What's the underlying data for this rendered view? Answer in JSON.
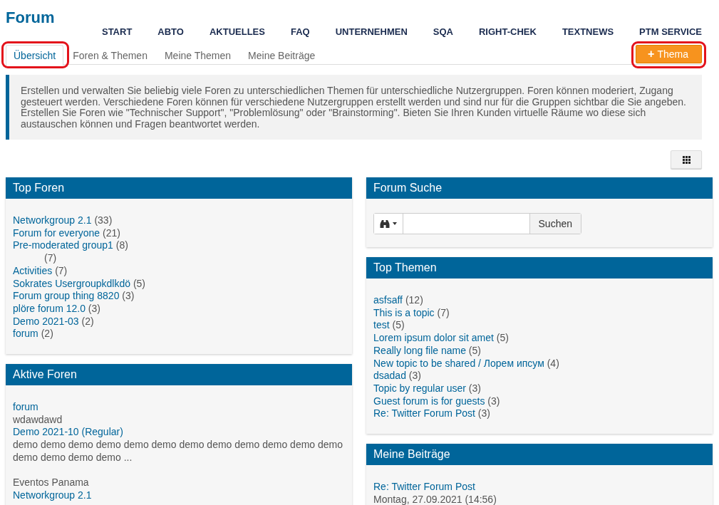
{
  "page_title": "Forum",
  "nav": [
    "START",
    "ABTO",
    "AKTUELLES",
    "FAQ",
    "UNTERNEHMEN",
    "SQA",
    "RIGHT-CHEK",
    "TEXTNEWS",
    "PTM SERVICE"
  ],
  "tabs": [
    {
      "label": "Übersicht",
      "selected": true,
      "highlighted": true
    },
    {
      "label": "Foren & Themen",
      "selected": false,
      "highlighted": false
    },
    {
      "label": "Meine Themen",
      "selected": false,
      "highlighted": false
    },
    {
      "label": "Meine Beiträge",
      "selected": false,
      "highlighted": false
    }
  ],
  "new_topic_button": {
    "icon": "+",
    "label": "Thema",
    "highlighted": true
  },
  "info_text": "Erstellen und verwalten Sie beliebig viele Foren zu unterschiedlichen Themen für unterschiedliche Nutzergruppen. Foren können moderiert, Zugang gesteuert werden. Verschiedene Foren können für verschiedene Nutzergruppen erstellt werden und sind nur für die Gruppen sichtbar die Sie angeben. Erstellen Sie Foren wie \"Technischer Support\", \"Problemlösung\" oder \"Brainstorming\". Bieten Sie Ihren Kunden virtuelle Räume wo diese sich austauschen können und Fragen beantwortet werden.",
  "top_foren": {
    "title": "Top Foren",
    "items": [
      {
        "name": "Networkgroup 2.1",
        "count": "(33)"
      },
      {
        "name": "Forum for everyone",
        "count": "(21)"
      },
      {
        "name": "Pre-moderated group1",
        "count": "(8)"
      },
      {
        "count": "(7)"
      },
      {
        "name": "Activities",
        "count": "(7)"
      },
      {
        "name": "Sokrates Usergroupkdlkdö",
        "count": "(5)"
      },
      {
        "name": "Forum group thing 8820",
        "count": "(3)"
      },
      {
        "name": "plöre forum 12.0",
        "count": "(3)"
      },
      {
        "name": "Demo 2021-03",
        "count": "(2)"
      },
      {
        "name": "forum",
        "count": "(2)"
      }
    ]
  },
  "aktive_foren": {
    "title": "Aktive Foren",
    "items": [
      {
        "kind": "link",
        "text": "forum",
        "gap_before": false
      },
      {
        "kind": "text",
        "text": "wdawdawd",
        "gap_before": false
      },
      {
        "kind": "link",
        "text": "Demo 2021-10 (Regular)",
        "gap_before": false
      },
      {
        "kind": "text",
        "text": "demo demo demo demo demo demo demo demo demo demo demo demo demo demo demo demo ...",
        "gap_before": false
      },
      {
        "kind": "text",
        "text": "Eventos Panama",
        "gap_before": true
      },
      {
        "kind": "link",
        "text": "Networkgroup 2.1",
        "gap_before": false
      }
    ]
  },
  "forum_suche": {
    "title": "Forum Suche",
    "button": "Suchen"
  },
  "top_themen": {
    "title": "Top Themen",
    "items": [
      {
        "name": "asfsaff",
        "count": "(12)"
      },
      {
        "name": "This is a topic",
        "count": "(7)"
      },
      {
        "name": "test",
        "count": "(5)"
      },
      {
        "name": "Lorem ipsum dolor sit amet",
        "count": "(5)"
      },
      {
        "name": "Really long file name",
        "count": "(5)"
      },
      {
        "name": "New topic to be shared / Лорем ипсум",
        "count": "(4)"
      },
      {
        "name": "dsadad",
        "count": "(3)"
      },
      {
        "name": "Topic by regular user",
        "count": "(3)"
      },
      {
        "name": "Guest forum is for guests",
        "count": "(3)"
      },
      {
        "name": "Re: Twitter Forum Post",
        "count": "(3)"
      }
    ]
  },
  "meine_beitraege": {
    "title": "Meine Beiträge",
    "items": [
      {
        "title": "Re: Twitter Forum Post",
        "date": "Montag, 27.09.2021 (14:56)"
      }
    ]
  }
}
